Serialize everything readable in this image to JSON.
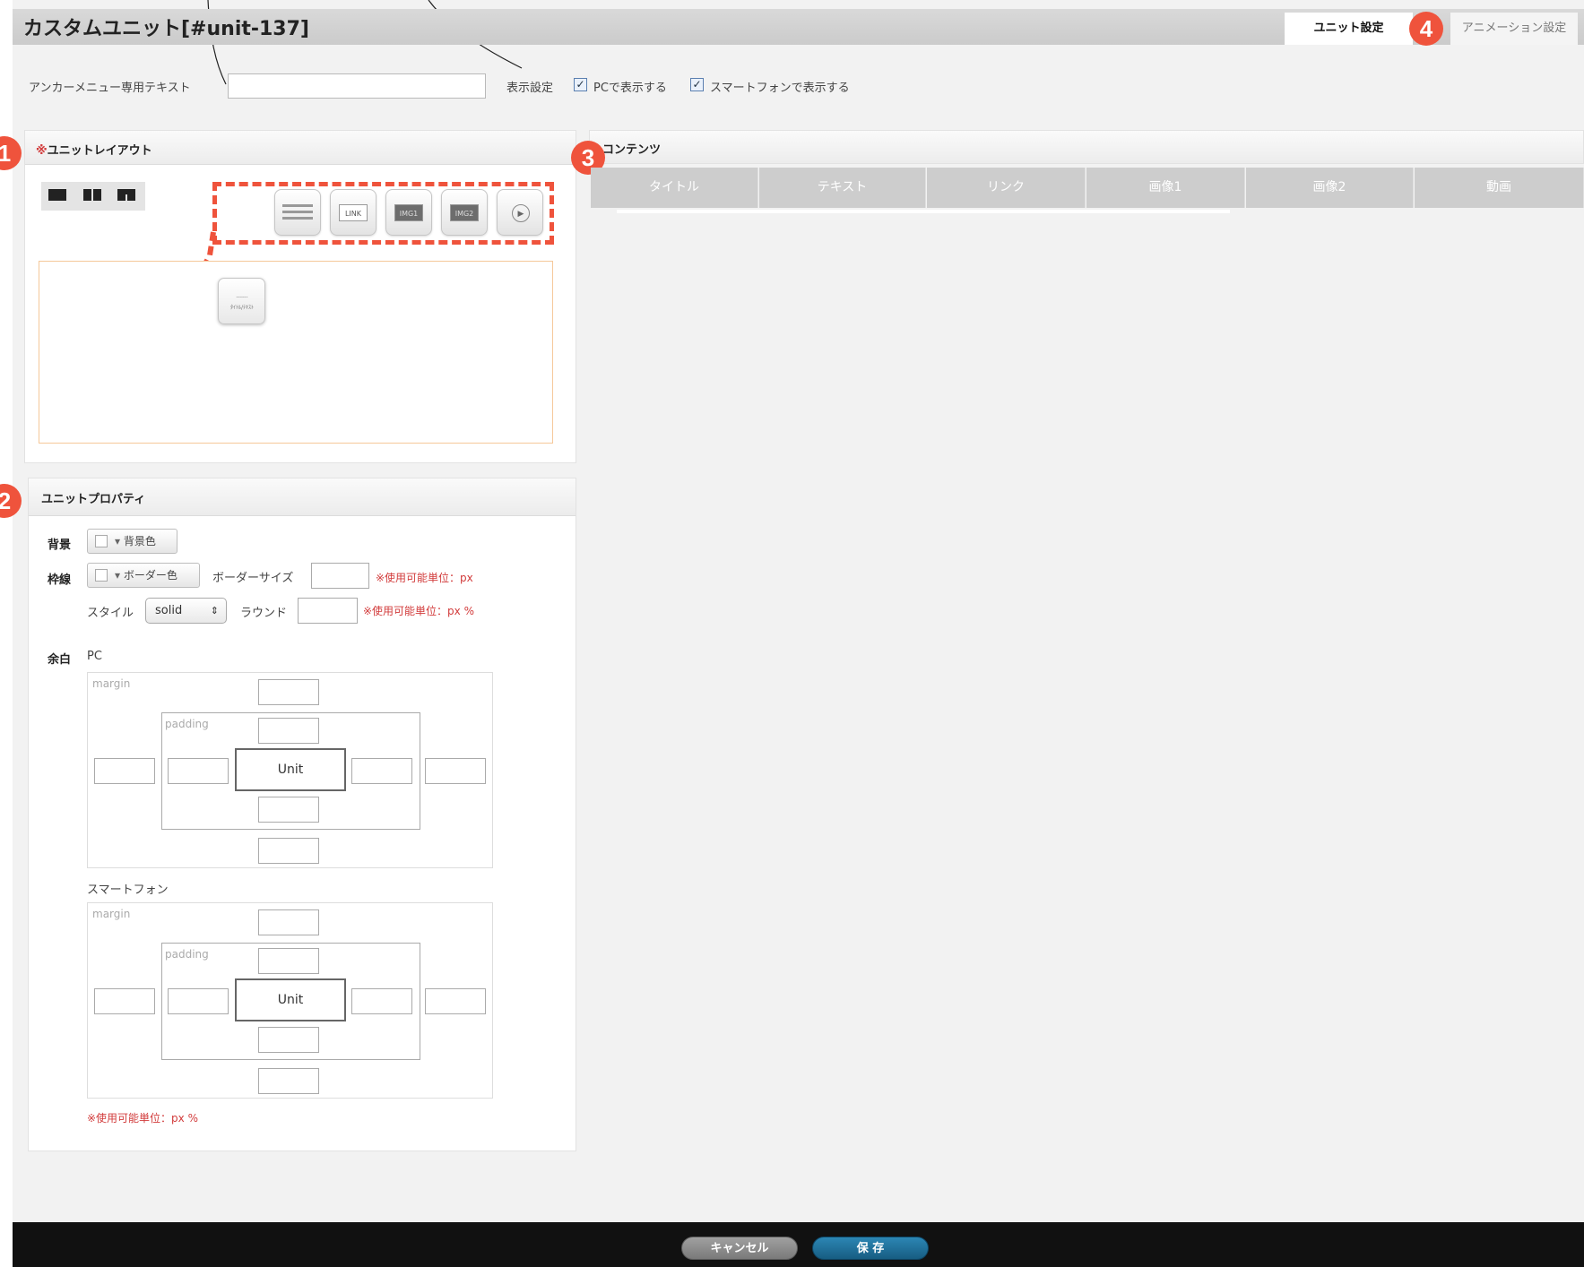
{
  "window": {
    "title": "カスタムユニット[#unit-137]",
    "tabs": [
      "ユニット設定",
      "アニメーション設定"
    ]
  },
  "badges": [
    "1",
    "2",
    "3",
    "4"
  ],
  "anchor": {
    "label": "アンカーメニュー専用テキスト",
    "value": ""
  },
  "display": {
    "label": "表示設定",
    "pc_label": "PCで表示する",
    "sp_label": "スマートフォンで表示する",
    "pc_checked": true,
    "sp_checked": true
  },
  "layout_section": {
    "title_mark": "※",
    "title": "ユニットレイアウト"
  },
  "parts": [
    "",
    "LINK",
    "IMG1",
    "IMG2",
    "▶"
  ],
  "dragged_part": {
    "top_text": "------",
    "bottom_text": "ﾀｲﾄﾙ/ﾃｷｽﾄ"
  },
  "contents": {
    "title": "コンテンツ",
    "columns": [
      "タイトル",
      "テキスト",
      "リンク",
      "画像1",
      "画像2",
      "動画"
    ]
  },
  "properties": {
    "title": "ユニットプロパティ",
    "background_label": "背景",
    "background_button": "背景色",
    "border_label": "枠線",
    "border_button": "ボーダー色",
    "border_size_label": "ボーダーサイズ",
    "border_size_note": "※使用可能単位：px",
    "style_label": "スタイル",
    "style_value": "solid",
    "round_label": "ラウンド",
    "round_note": "※使用可能単位：px %",
    "margin_label": "余白",
    "pc_label": "PC",
    "sp_label": "スマートフォン",
    "margin_text": "margin",
    "padding_text": "padding",
    "unit_text": "Unit",
    "bottom_note": "※使用可能単位：px %"
  },
  "footer": {
    "cancel": "キャンセル",
    "save": "保 存"
  },
  "colors": {
    "badge": "#ef533c",
    "save_button": "#1f6d96",
    "cancel_button": "#8a8a8a",
    "dashed": "#ef533c"
  }
}
